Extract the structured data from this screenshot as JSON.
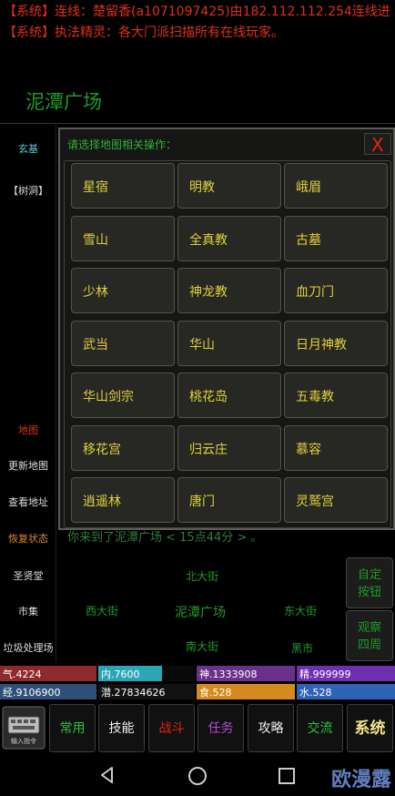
{
  "system_log": [
    "【系统】连线：楚留香(a1071097425)由182.112.112.254连线进",
    "【系统】执法精灵：各大门派扫描所有在线玩家。"
  ],
  "header": {
    "title": "泥潭广场"
  },
  "sidebar": {
    "items": [
      "玄基",
      "【树洞】",
      "地图",
      "更新地图",
      "查看地址",
      "恢复状态",
      "圣贤堂",
      "市集",
      "垃圾处理场"
    ]
  },
  "dialog": {
    "prompt": "请选择地图相关操作：",
    "close_label": "X",
    "options": [
      "星宿",
      "明教",
      "峨眉",
      "雪山",
      "全真教",
      "古墓",
      "少林",
      "神龙教",
      "血刀门",
      "武当",
      "华山",
      "日月神教",
      "华山剑宗",
      "桃花岛",
      "五毒教",
      "移花宫",
      "归云庄",
      "慕容",
      "逍遥林",
      "唐门",
      "灵鹫宫"
    ]
  },
  "status_line": "你来到了泥潭广场 < 15点44分 > 。",
  "map": {
    "north": "北大街",
    "west": "西大街",
    "center": "泥潭广场",
    "east": "东大街",
    "south": "南大街",
    "southeast": "黑市",
    "btn_custom": "自定按钮",
    "btn_observe": "观察四周"
  },
  "stats": {
    "qi": {
      "label": "气.4224",
      "fraction": 1.0,
      "color": "#8e2a2e"
    },
    "nei": {
      "label": "内.7600",
      "fraction": 0.66,
      "color": "#2aa6b4"
    },
    "shen": {
      "label": "神.1333908",
      "fraction": 1.0,
      "color": "#6b2f8c"
    },
    "jing": {
      "label": "精.999999",
      "fraction": 1.0,
      "color": "#6e2fb0"
    },
    "exp": {
      "label": "经.9106900",
      "fraction": 1.0,
      "color": "#2f4f7a"
    },
    "qian": {
      "label": "潜.27834626",
      "fraction": 0.0,
      "color": "#1a1a1a"
    },
    "food": {
      "label": "食.528",
      "fraction": 1.0,
      "color": "#d48a1e"
    },
    "water": {
      "label": "水.528",
      "fraction": 1.0,
      "color": "#2f63b8"
    }
  },
  "toolbar": {
    "input_label": "输入指令",
    "items": [
      {
        "label": "常用",
        "style": "green"
      },
      {
        "label": "技能",
        "style": "white"
      },
      {
        "label": "战斗",
        "style": "red"
      },
      {
        "label": "任务",
        "style": "purple"
      },
      {
        "label": "攻略",
        "style": "white"
      },
      {
        "label": "交流",
        "style": "green"
      },
      {
        "label": "系统",
        "style": "gold"
      }
    ]
  },
  "watermark": "欧漫露"
}
